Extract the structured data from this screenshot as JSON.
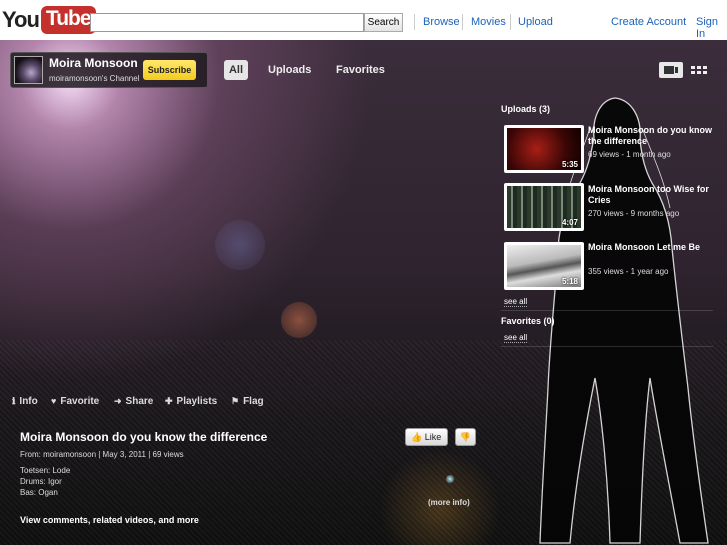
{
  "header": {
    "logo_you": "You",
    "logo_tube": "Tube",
    "search_button": "Search",
    "nav": [
      "Browse",
      "Movies",
      "Upload"
    ],
    "create_account": "Create Account",
    "sign_in": "Sign In"
  },
  "channel": {
    "name": "Moira Monsoon",
    "subtitle": "moiramonsoon's Channel",
    "subscribe_label": "Subscribe",
    "tabs": [
      "All",
      "Uploads",
      "Favorites"
    ],
    "active_tab": "All"
  },
  "uploads": {
    "heading": "Uploads (3)",
    "videos": [
      {
        "title": "Moira Monsoon do you know the difference",
        "meta": "69 views - 1 month ago",
        "duration": "5:35"
      },
      {
        "title": "Moira Monsoon too Wise for Cries",
        "meta": "270 views - 9 months ago",
        "duration": "4:07"
      },
      {
        "title": "Moira Monsoon Let me Be",
        "meta": "355 views - 1 year ago",
        "duration": "5:18"
      }
    ],
    "see_all": "see all"
  },
  "favorites": {
    "heading": "Favorites (0)",
    "see_all": "see all"
  },
  "actions": {
    "info": "Info",
    "favorite": "Favorite",
    "share": "Share",
    "playlists": "Playlists",
    "flag": "Flag"
  },
  "video": {
    "title": "Moira Monsoon do you know the difference",
    "from": "From: moiramonsoon  | May 3, 2011  | 69 views",
    "description": [
      "Toetsen: Lode",
      "Drums: Igor",
      "Bas: Ogan"
    ],
    "like_label": "Like",
    "more_info": "(more info)",
    "view_comments": "View comments, related videos, and more"
  },
  "colors": {
    "brand_red": "#c4302b",
    "link_blue": "#1c62b9",
    "subscribe_yellow": "#f4cc1e"
  }
}
